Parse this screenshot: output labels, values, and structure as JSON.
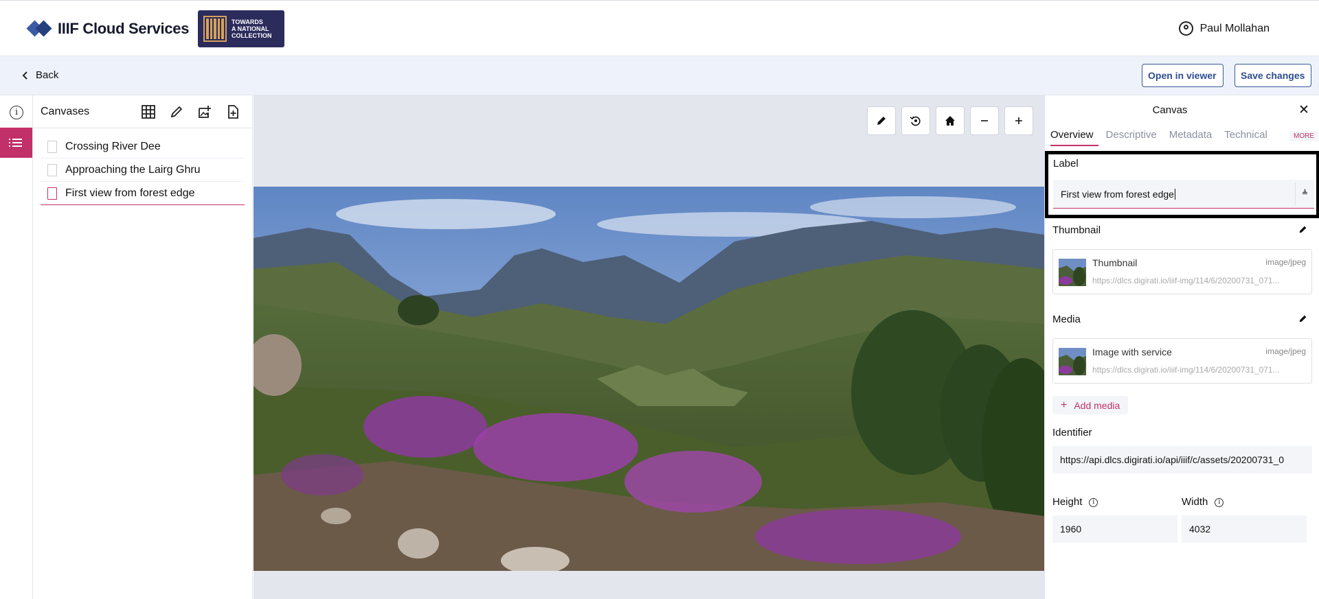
{
  "header": {
    "brand": "IIIF Cloud Services",
    "partner_logo": "TOWARDS A NATIONAL COLLECTION",
    "user_name": "Paul Mollahan"
  },
  "actionbar": {
    "back_label": "Back",
    "open_viewer_label": "Open in viewer",
    "save_label": "Save changes"
  },
  "canvases": {
    "title": "Canvases",
    "tools": [
      "grid-icon",
      "pencil-icon",
      "image-add-icon",
      "file-add-icon"
    ],
    "items": [
      {
        "label": "Crossing River Dee",
        "active": false
      },
      {
        "label": "Approaching the Lairg Ghru",
        "active": false
      },
      {
        "label": "First view from forest edge",
        "active": true
      }
    ]
  },
  "viewer": {
    "tools": [
      "pencil-icon",
      "rotate-icon",
      "home-icon",
      "zoom-out-icon",
      "zoom-in-icon"
    ]
  },
  "panel": {
    "title": "Canvas",
    "tabs": [
      "Overview",
      "Descriptive",
      "Metadata",
      "Technical"
    ],
    "active_tab": "Overview",
    "more_label": "MORE",
    "label_title": "Label",
    "label_value": "First view from forest edge",
    "thumbnail_title": "Thumbnail",
    "thumbnail_card": {
      "name": "Thumbnail",
      "type": "image/jpeg",
      "url": "https://dlcs.digirati.io/iiif-img/114/6/20200731_071..."
    },
    "media_title": "Media",
    "media_card": {
      "name": "Image with service",
      "type": "image/jpeg",
      "url": "https://dlcs.digirati.io/iiif-img/114/6/20200731_071..."
    },
    "add_media_label": "Add media",
    "identifier_title": "Identifier",
    "identifier_value": "https://api.dlcs.digirati.io/api/iiif/c/assets/20200731_0",
    "height_title": "Height",
    "height_value": "1960",
    "width_title": "Width",
    "width_value": "4032"
  },
  "colors": {
    "accent": "#c2306a",
    "brand_blue": "#2e4d93",
    "header_band": "#eef3fb"
  }
}
